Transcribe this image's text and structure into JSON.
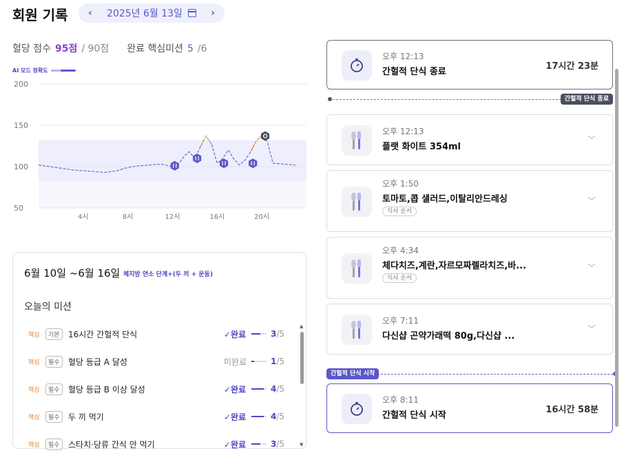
{
  "header": {
    "title": "회원 기록",
    "date": "2025년 6월 13일",
    "prev_icon": "chevron-left-icon",
    "next_icon": "chevron-right-icon",
    "calendar_icon": "calendar-icon"
  },
  "scores": {
    "glucose_label": "혈당 점수",
    "glucose_value": "95점",
    "glucose_total": "/ 90점",
    "mission_label": "완료 핵심미션",
    "mission_done": "5",
    "mission_total": "/6"
  },
  "ai_label": "AI 모드 정확도",
  "chart_data": {
    "type": "line",
    "ylim": [
      50,
      200
    ],
    "yticks": [
      200,
      150,
      100,
      50
    ],
    "xticks": [
      "4시",
      "8시",
      "12시",
      "16시",
      "20시"
    ],
    "x_hours": [
      4,
      8,
      12,
      16,
      20
    ],
    "target_band": [
      82,
      132
    ],
    "series": [
      {
        "x": [
          0,
          1,
          2,
          3,
          4,
          5,
          6,
          7,
          8,
          9,
          10,
          11,
          12,
          12.5,
          13,
          13.5,
          14,
          14.5,
          15,
          15.5,
          16,
          16.5,
          17,
          17.5,
          18,
          18.5,
          19,
          19.5,
          20,
          20.5,
          21,
          22,
          23
        ],
        "y": [
          102,
          100,
          98,
          96,
          95,
          94,
          93,
          95,
          99,
          101,
          102,
          103,
          100,
          102,
          112,
          118,
          110,
          124,
          137,
          127,
          104,
          110,
          120,
          109,
          102,
          108,
          118,
          131,
          138,
          130,
          104,
          103,
          102
        ]
      }
    ],
    "events": [
      {
        "x": 12.2,
        "y": 101,
        "icon": "fork-knife-icon"
      },
      {
        "x": 14.2,
        "y": 110,
        "icon": "fork-knife-icon"
      },
      {
        "x": 16.6,
        "y": 104,
        "icon": "fork-knife-icon"
      },
      {
        "x": 19.2,
        "y": 104,
        "icon": "fork-knife-icon"
      },
      {
        "x": 20.3,
        "y": 137,
        "icon": "peak-icon"
      }
    ],
    "colors": {
      "line": "#6b67d4",
      "spike": "#f0a030",
      "band": "#eeeefc"
    }
  },
  "missions": {
    "week": "6월 10일 ~6월 16일",
    "week_tag": "체지방 연소 단계+(두 끼 + 운동)",
    "title": "오늘의 미션",
    "items": [
      {
        "core": "핵심",
        "badge": "기본",
        "name": "16시간 간헐적 단식",
        "status": "✓완료",
        "done": 3,
        "total": "/5",
        "progress": 0.6
      },
      {
        "core": "핵심",
        "badge": "필수",
        "name": "혈당 등급 A 달성",
        "status": "미완료",
        "done": 1,
        "total": "/5",
        "progress": 0.2
      },
      {
        "core": "핵심",
        "badge": "필수",
        "name": "혈당 등급 B 이상 달성",
        "status": "✓완료",
        "done": 4,
        "total": "/5",
        "progress": 0.8
      },
      {
        "core": "핵심",
        "badge": "필수",
        "name": "두 끼 먹기",
        "status": "✓완료",
        "done": 4,
        "total": "/5",
        "progress": 0.8
      },
      {
        "core": "핵심",
        "badge": "필수",
        "name": "스타치·당류 간식 안 먹기",
        "status": "✓완료",
        "done": 3,
        "total": "/5",
        "progress": 0.6
      }
    ]
  },
  "timeline": {
    "items": [
      {
        "time": "오후 12:13",
        "label": "간헐적 단식 종료",
        "duration": "17시간 23분",
        "type": "fast-end"
      },
      {
        "divider": "간헐적 단식 종료"
      },
      {
        "time": "오후 12:13",
        "label": "플랫 화이트 354ml",
        "type": "meal"
      },
      {
        "time": "오후 1:50",
        "label": "토마토,콥 샐러드,이탈리안드레싱",
        "tag": "식사 순서",
        "type": "meal"
      },
      {
        "time": "오후 4:34",
        "label": "체다치즈,계란,자르모짜렐라치즈,바...",
        "tag": "식사 순서",
        "type": "meal"
      },
      {
        "time": "오후 7:11",
        "label": "다신샵 곤약가래떡 80g,다신샵 ...",
        "type": "meal"
      },
      {
        "divider": "간헐적 단식 시작"
      },
      {
        "time": "오후 8:11",
        "label": "간헐적 단식 시작",
        "duration": "16시간 58분",
        "type": "fast-start"
      }
    ]
  }
}
